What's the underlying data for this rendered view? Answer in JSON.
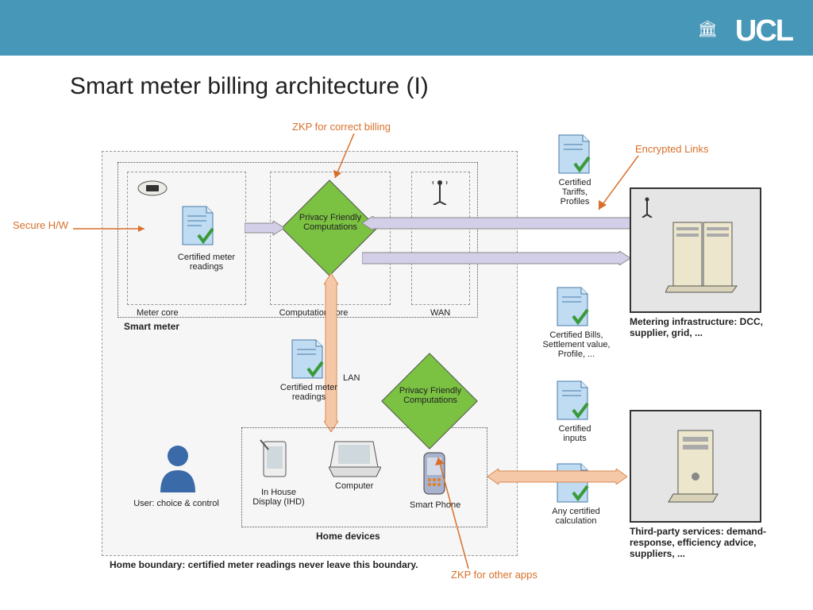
{
  "header": {
    "logo": "UCL"
  },
  "title": "Smart meter billing architecture (I)",
  "annotations": {
    "zkp_billing": "ZKP for correct billing",
    "encrypted_links": "Encrypted Links",
    "secure_hw": "Secure H/W",
    "zkp_other": "ZKP for other apps"
  },
  "boxes": {
    "home_boundary": "Home boundary: certified meter readings never leave this boundary.",
    "smart_meter": "Smart meter",
    "meter_core": "Meter core",
    "computation_core": "Computation core",
    "wan": "WAN",
    "home_devices": "Home devices",
    "lan": "LAN",
    "metering_infra": "Metering infrastructure: DCC, supplier, grid, ...",
    "third_party": "Third-party services: demand-response, efficiency advice, suppliers, ..."
  },
  "nodes": {
    "pfc1": "Privacy Friendly Computations",
    "pfc2": "Privacy Friendly Computations",
    "cert_readings1": "Certified meter readings",
    "cert_readings2": "Certified meter readings",
    "cert_tariffs": "Certified Tariffs, Profiles",
    "cert_bills": "Certified Bills, Settlement value, Profile, ...",
    "cert_inputs": "Certified inputs",
    "any_cert": "Any certified calculation",
    "ihd": "In House Display (IHD)",
    "computer": "Computer",
    "smartphone": "Smart Phone",
    "user": "User: choice & control"
  }
}
